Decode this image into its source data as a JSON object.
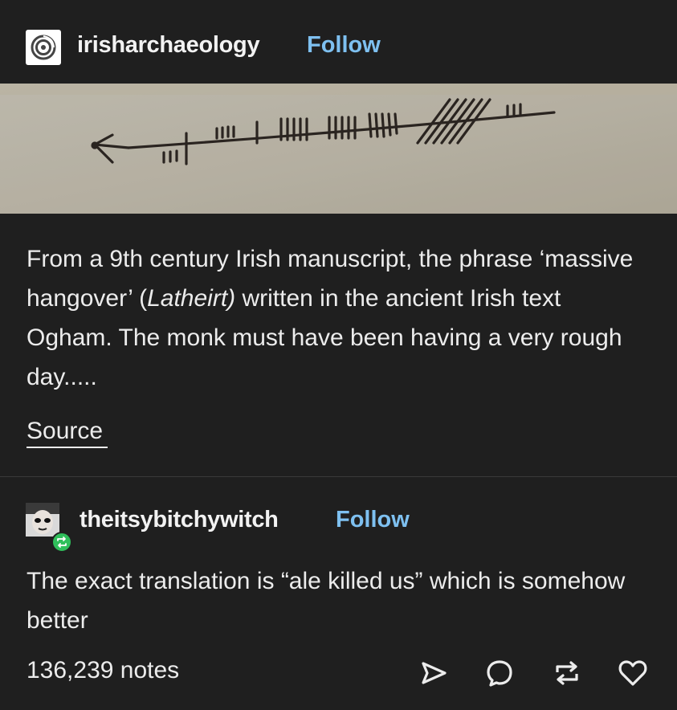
{
  "post": {
    "blog_name": "irisharchaeology",
    "follow_label": "Follow",
    "caption_part1": "From a 9th century Irish manuscript, the phrase ‘massive hangover’ (",
    "caption_italic": "Latheirt)",
    "caption_part2": " written in the ancient Irish text Ogham. The monk must have been having a very rough day.....",
    "source_label": "Source"
  },
  "reblog": {
    "blog_name": "theitsybitchywitch",
    "follow_label": "Follow",
    "text": "The exact translation is “ale killed us” which is somehow better"
  },
  "footer": {
    "notes": "136,239 notes",
    "actions": [
      "share-icon",
      "reply-icon",
      "reblog-icon",
      "like-icon"
    ]
  },
  "colors": {
    "background": "#1f1f1f",
    "follow": "#7ec0f0",
    "text": "#ececec",
    "reblog_badge": "#2fbf5b"
  }
}
